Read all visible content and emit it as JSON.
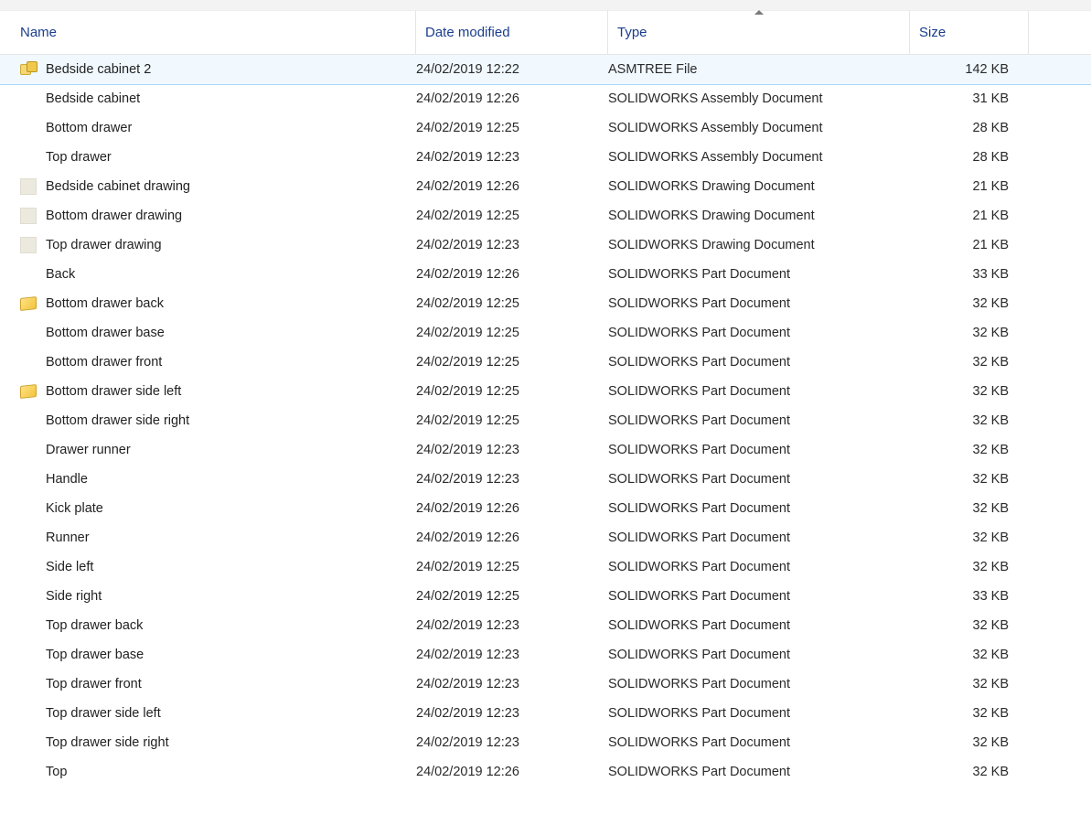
{
  "columns": {
    "name": "Name",
    "date": "Date modified",
    "type": "Type",
    "size": "Size",
    "sorted": "type"
  },
  "files": [
    {
      "icon": "asm",
      "name": "Bedside cabinet 2",
      "date": "24/02/2019 12:22",
      "type": "ASMTREE File",
      "size": "142 KB",
      "selected": true
    },
    {
      "icon": "none",
      "name": "Bedside cabinet",
      "date": "24/02/2019 12:26",
      "type": "SOLIDWORKS Assembly Document",
      "size": "31 KB"
    },
    {
      "icon": "none",
      "name": "Bottom drawer",
      "date": "24/02/2019 12:25",
      "type": "SOLIDWORKS Assembly Document",
      "size": "28 KB"
    },
    {
      "icon": "none",
      "name": "Top drawer",
      "date": "24/02/2019 12:23",
      "type": "SOLIDWORKS Assembly Document",
      "size": "28 KB"
    },
    {
      "icon": "blank",
      "name": "Bedside cabinet drawing",
      "date": "24/02/2019 12:26",
      "type": "SOLIDWORKS Drawing Document",
      "size": "21 KB"
    },
    {
      "icon": "blank",
      "name": "Bottom drawer drawing",
      "date": "24/02/2019 12:25",
      "type": "SOLIDWORKS Drawing Document",
      "size": "21 KB"
    },
    {
      "icon": "blank",
      "name": "Top drawer drawing",
      "date": "24/02/2019 12:23",
      "type": "SOLIDWORKS Drawing Document",
      "size": "21 KB"
    },
    {
      "icon": "none",
      "name": "Back",
      "date": "24/02/2019 12:26",
      "type": "SOLIDWORKS Part Document",
      "size": "33 KB"
    },
    {
      "icon": "part",
      "name": "Bottom drawer back",
      "date": "24/02/2019 12:25",
      "type": "SOLIDWORKS Part Document",
      "size": "32 KB"
    },
    {
      "icon": "none",
      "name": "Bottom drawer base",
      "date": "24/02/2019 12:25",
      "type": "SOLIDWORKS Part Document",
      "size": "32 KB"
    },
    {
      "icon": "none",
      "name": "Bottom drawer front",
      "date": "24/02/2019 12:25",
      "type": "SOLIDWORKS Part Document",
      "size": "32 KB"
    },
    {
      "icon": "part",
      "name": "Bottom drawer side left",
      "date": "24/02/2019 12:25",
      "type": "SOLIDWORKS Part Document",
      "size": "32 KB"
    },
    {
      "icon": "none",
      "name": "Bottom drawer side right",
      "date": "24/02/2019 12:25",
      "type": "SOLIDWORKS Part Document",
      "size": "32 KB"
    },
    {
      "icon": "none",
      "name": "Drawer runner",
      "date": "24/02/2019 12:23",
      "type": "SOLIDWORKS Part Document",
      "size": "32 KB"
    },
    {
      "icon": "none",
      "name": "Handle",
      "date": "24/02/2019 12:23",
      "type": "SOLIDWORKS Part Document",
      "size": "32 KB"
    },
    {
      "icon": "none",
      "name": "Kick plate",
      "date": "24/02/2019 12:26",
      "type": "SOLIDWORKS Part Document",
      "size": "32 KB"
    },
    {
      "icon": "none",
      "name": "Runner",
      "date": "24/02/2019 12:26",
      "type": "SOLIDWORKS Part Document",
      "size": "32 KB"
    },
    {
      "icon": "none",
      "name": "Side left",
      "date": "24/02/2019 12:25",
      "type": "SOLIDWORKS Part Document",
      "size": "32 KB"
    },
    {
      "icon": "none",
      "name": "Side right",
      "date": "24/02/2019 12:25",
      "type": "SOLIDWORKS Part Document",
      "size": "33 KB"
    },
    {
      "icon": "none",
      "name": "Top drawer back",
      "date": "24/02/2019 12:23",
      "type": "SOLIDWORKS Part Document",
      "size": "32 KB"
    },
    {
      "icon": "none",
      "name": "Top drawer base",
      "date": "24/02/2019 12:23",
      "type": "SOLIDWORKS Part Document",
      "size": "32 KB"
    },
    {
      "icon": "none",
      "name": "Top drawer front",
      "date": "24/02/2019 12:23",
      "type": "SOLIDWORKS Part Document",
      "size": "32 KB"
    },
    {
      "icon": "none",
      "name": "Top drawer side left",
      "date": "24/02/2019 12:23",
      "type": "SOLIDWORKS Part Document",
      "size": "32 KB"
    },
    {
      "icon": "none",
      "name": "Top drawer side right",
      "date": "24/02/2019 12:23",
      "type": "SOLIDWORKS Part Document",
      "size": "32 KB"
    },
    {
      "icon": "none",
      "name": "Top",
      "date": "24/02/2019 12:26",
      "type": "SOLIDWORKS Part Document",
      "size": "32 KB"
    }
  ]
}
